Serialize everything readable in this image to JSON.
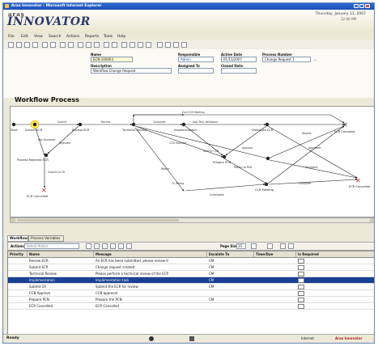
{
  "window": {
    "title": "Aras Innovator - Microsoft Internet Explorer"
  },
  "header": {
    "brand_top": "aras",
    "brand": "INNOVATOR",
    "date": "Thursday, January 11, 2007",
    "time": "12:00 AM"
  },
  "menu": [
    "File",
    "Edit",
    "View",
    "Search",
    "Actions",
    "Reports",
    "Tools",
    "Help"
  ],
  "form": {
    "name_label": "Name",
    "name_value": "ECN-140003",
    "description_label": "Description",
    "description_value": "Workflow Change Request",
    "responsible_label": "Responsible",
    "responsible_value": "Admin",
    "assigned_label": "Assigned To",
    "assigned_value": "",
    "active_date_label": "Active Date",
    "active_date_value": "01/11/2007",
    "closed_date_label": "Closed Date",
    "closed_date_value": "",
    "process_label": "Process Number",
    "process_value": "Change Request 1",
    "process_btn": "..."
  },
  "workflow": {
    "title": "Workflow Process",
    "nodes": [
      {
        "id": "start",
        "label": "Start",
        "label2": "Submit ECR"
      },
      {
        "id": "review",
        "label": "Review ECR"
      },
      {
        "id": "tech",
        "label": "Technical Review"
      },
      {
        "id": "impl",
        "label": "Implementation"
      },
      {
        "id": "provide",
        "label": "Provide ECR"
      },
      {
        "id": "prepare",
        "label": "Prepare PCN"
      },
      {
        "id": "distribute",
        "label": "Distribute ECR"
      },
      {
        "id": "ccb",
        "label": "CCB Meeting"
      },
      {
        "id": "end1",
        "label": "ECR Complete"
      },
      {
        "id": "end2",
        "label": "ECR Cancelled"
      },
      {
        "id": "processing",
        "label": "Process Rejected ECR"
      },
      {
        "id": "cancel",
        "label": "ECR Cancelled"
      }
    ],
    "edge_labels": [
      "Submit",
      "Review",
      "Not Accepted",
      "Rejected",
      "Submit to CR",
      "Complete",
      "Add Tech Validation",
      "CCB required",
      "Sent to CCB",
      "Approve",
      "Return to PAD",
      "Reject",
      "Exit CCB Meeting",
      "In Wrong",
      "Investigate",
      "Rework",
      "Approved",
      "Reviewed",
      "Complete"
    ]
  },
  "tabs": [
    "Workflow",
    "Process Variables"
  ],
  "gridbar": {
    "actions_label": "Actions",
    "actions_value": "Select Action",
    "page_size_label": "Page Size",
    "page_size_value": "25"
  },
  "grid": {
    "columns": [
      "Priority",
      "Name",
      "Message",
      "Escalate To",
      "Time/Due",
      "Is Required"
    ],
    "rows": [
      {
        "priority": "",
        "name": "Review ECR",
        "message": "An ECR has been submitted, please review it",
        "escalate": "CM",
        "time": "",
        "required": false,
        "selected": false
      },
      {
        "priority": "",
        "name": "Submit ECR",
        "message": "Change request created",
        "escalate": "CM",
        "time": "",
        "required": false,
        "selected": false
      },
      {
        "priority": "",
        "name": "Technical Review",
        "message": "Please perform a technical review of the ECR",
        "escalate": "CM",
        "time": "",
        "required": false,
        "selected": false
      },
      {
        "priority": "",
        "name": "Implementation",
        "message": "Implementation task",
        "escalate": "CM",
        "time": "",
        "required": true,
        "selected": true
      },
      {
        "priority": "",
        "name": "Submit CR",
        "message": "Submit the ECR for review",
        "escalate": "CM",
        "time": "",
        "required": false,
        "selected": false
      },
      {
        "priority": "",
        "name": "CCB Approve",
        "message": "CCB approval",
        "escalate": "",
        "time": "",
        "required": false,
        "selected": false
      },
      {
        "priority": "",
        "name": "Prepare PCN",
        "message": "Prepare the PCN",
        "escalate": "CM",
        "time": "",
        "required": false,
        "selected": false
      },
      {
        "priority": "",
        "name": "ECR Cancelled",
        "message": "ECR Cancelled",
        "escalate": "",
        "time": "",
        "required": false,
        "selected": false
      }
    ]
  },
  "status": {
    "left": "Ready",
    "zone": "Internet",
    "brand": "Aras Innovator"
  }
}
